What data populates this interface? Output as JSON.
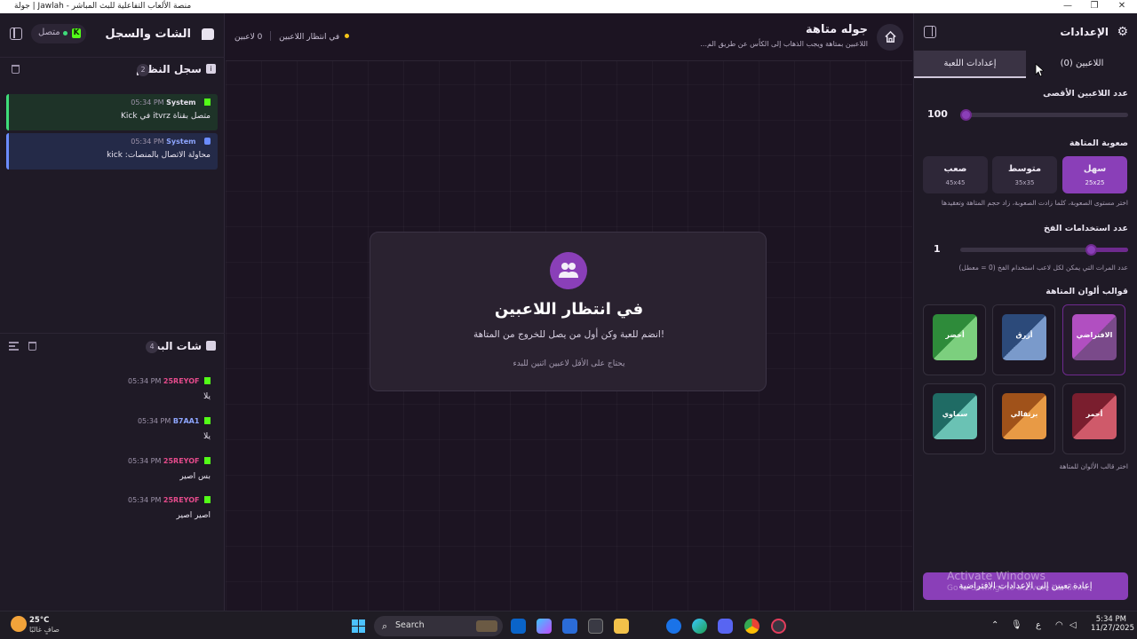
{
  "window": {
    "title": "منصة الألعاب التفاعلية للبث المباشر - Jawlah | جولة",
    "minimize": "—",
    "maximize": "❐",
    "close": "✕"
  },
  "left": {
    "title": "الشات والسجل",
    "connection": "متصل",
    "kick_letter": "K",
    "system_log": {
      "title": "سجل النظام",
      "count": "2",
      "messages": [
        {
          "user": "System",
          "time": "05:34 PM",
          "text": "متصل بقناة itvrz في Kick",
          "platform": "kick"
        },
        {
          "user": "System",
          "time": "05:34 PM",
          "text": "محاولة الاتصال بالمنصات: kick",
          "platform": "discord"
        }
      ]
    },
    "stream_chat": {
      "title": "شات البث",
      "count": "4",
      "messages": [
        {
          "user": "25REYOF",
          "time": "05:34 PM",
          "text": "يلا",
          "color": "#e64b8c"
        },
        {
          "user": "B7AA1",
          "time": "05:34 PM",
          "text": "يلا",
          "color": "#8ea6ff"
        },
        {
          "user": "25REYOF",
          "time": "05:34 PM",
          "text": "بس اصير",
          "color": "#e64b8c"
        },
        {
          "user": "25REYOF",
          "time": "05:34 PM",
          "text": "اصير اصير",
          "color": "#e64b8c"
        }
      ]
    }
  },
  "center": {
    "title": "جوله متاهة",
    "subtitle": "اللاعبين بمتاهة ويجب الذهاب إلى الكأس عن طريق الم...",
    "players_status": "0 لاعبين",
    "waiting_status": "في انتظار اللاعبين",
    "card": {
      "title": "في انتظار اللاعبين",
      "subtitle": "انضم للعبة وكن أول من يصل للخروج من المتاهة!",
      "note": "يحتاج على الأقل لاعبين اثنين للبدء"
    }
  },
  "right": {
    "title": "الإعدادات",
    "gear": "⚙",
    "tabs": [
      {
        "label": "اللاعبين (0)"
      },
      {
        "label": "إعدادات اللعبة"
      }
    ],
    "max_players": {
      "label": "عدد اللاعبين الأقصى",
      "value": "100",
      "fraction": 0.0
    },
    "difficulty": {
      "label": "صعوبة المتاهة",
      "options": [
        {
          "name": "سهل",
          "size": "25x25"
        },
        {
          "name": "متوسط",
          "size": "35x35"
        },
        {
          "name": "صعب",
          "size": "45x45"
        }
      ],
      "selected": "سهل",
      "hint": "اختر مستوى الصعوبة، كلما زادت الصعوبة، زاد حجم المتاهة وتعقيدها"
    },
    "trap": {
      "label": "عدد استخدامات الفخ",
      "value": "1",
      "fraction": 0.2,
      "hint": "عدد المرات التي يمكن لكل لاعب استخدام الفخ (0 = معطل)"
    },
    "themes": {
      "label": "قوالب ألوان المتاهة",
      "items": [
        {
          "name": "الافتراضي",
          "from": "#b14fc1",
          "to": "#7a4a8a"
        },
        {
          "name": "أزرق",
          "from": "#2c4a7a",
          "to": "#7a9acb"
        },
        {
          "name": "أخضر",
          "from": "#2e8b3a",
          "to": "#7ccf7e"
        },
        {
          "name": "أحمر",
          "from": "#7a1e2e",
          "to": "#cf5a6a"
        },
        {
          "name": "برتقالي",
          "from": "#a0521a",
          "to": "#e89a45"
        },
        {
          "name": "سماوي",
          "from": "#1f6b64",
          "to": "#6ac2b4"
        }
      ],
      "hint": "اختر قالب الألوان للمتاهة"
    },
    "reset": "إعادة تعيين إلى الإعدادات الافتراضية"
  },
  "overlay": {
    "activate": "Activate Windows",
    "activate_sub": "Go to Settings to activate Windows."
  },
  "taskbar": {
    "temp": "25°C",
    "weather": "صافٍ غالبًا",
    "search": "Search",
    "lang": "ع",
    "time": "5:34 PM",
    "date": "11/27/2025"
  }
}
